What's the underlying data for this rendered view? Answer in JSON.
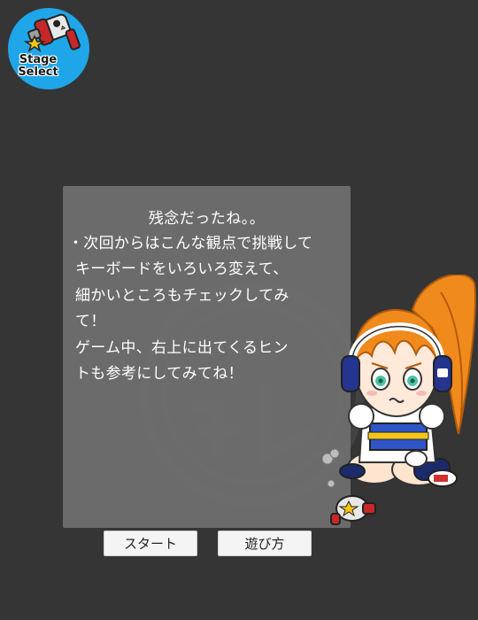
{
  "stage_select": {
    "line1": "Stage",
    "line2": "Select",
    "icon": "stage-select-badge-icon"
  },
  "panel": {
    "title": "残念だったね。。",
    "hint_heading": "・次回からはこんな観点で挑戦して",
    "hint_lines": [
      "キーボードをいろいろ変えて、",
      "細かいところもチェックしてみ",
      "て！",
      "ゲーム中、右上に出てくるヒン",
      "トも参考にしてみてね！"
    ]
  },
  "buttons": {
    "start": "スタート",
    "how_to_play": "遊び方"
  },
  "colors": {
    "background": "#353535",
    "panel": "#707070",
    "badge": "#1ea6e8",
    "hair": "#f08a1c"
  }
}
